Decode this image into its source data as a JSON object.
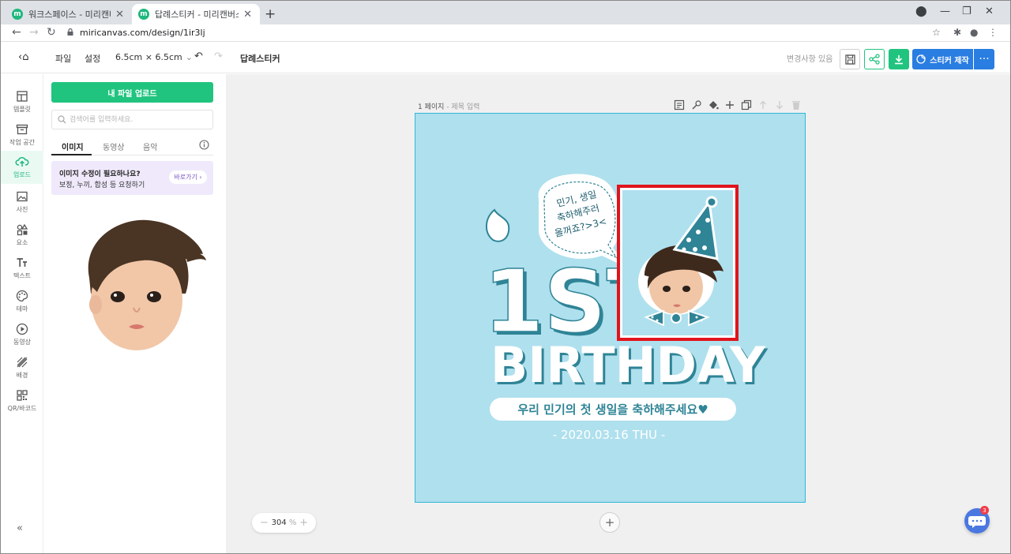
{
  "browser": {
    "tabs": [
      {
        "title": "워크스페이스 - 미리캔버스",
        "active": false
      },
      {
        "title": "답례스티커 - 미리캔버스",
        "active": true
      }
    ],
    "favicon_letter": "m",
    "url": "miricanvas.com/design/1ir3lj"
  },
  "header": {
    "menu_file": "파일",
    "menu_settings": "설정",
    "size": "6.5cm × 6.5cm",
    "doc_title": "답례스티커",
    "save_status": "변경사항 있음",
    "sticker_button": "스티커 제작",
    "more": "···"
  },
  "rail": {
    "items": [
      {
        "label": "템플릿",
        "icon": "template-icon"
      },
      {
        "label": "작업 공간",
        "icon": "workspace-icon"
      },
      {
        "label": "업로드",
        "icon": "upload-icon",
        "active": true
      },
      {
        "label": "사진",
        "icon": "photo-icon"
      },
      {
        "label": "요소",
        "icon": "elements-icon"
      },
      {
        "label": "텍스트",
        "icon": "text-icon"
      },
      {
        "label": "테마",
        "icon": "palette-icon"
      },
      {
        "label": "동영상",
        "icon": "video-icon"
      },
      {
        "label": "배경",
        "icon": "background-icon"
      },
      {
        "label": "QR/바코드",
        "icon": "qr-icon"
      }
    ],
    "collapse": "«"
  },
  "panel": {
    "upload_button": "내 파일 업로드",
    "search_placeholder": "검색어를 입력하세요.",
    "tabs": [
      "이미지",
      "동영상",
      "음악"
    ],
    "promo_title": "이미지 수정이 필요하나요?",
    "promo_sub": "보정, 누끼, 합성 등 요청하기",
    "promo_button": "바로가기 ›"
  },
  "workspace": {
    "page_number": "1 페이지",
    "page_title_placeholder": "- 제목 입력",
    "zoom_value": "304",
    "zoom_unit": "%",
    "zoom_minus": "−",
    "zoom_plus": "+",
    "add_page": "+",
    "chat_badge": "3"
  },
  "design": {
    "bubble_text": [
      "민기, 생일",
      "축하해주러",
      "올꺼죠?>3<"
    ],
    "big_text": "1ST",
    "birthday": "BIRTHDAY",
    "banner": "우리 민기의 첫 생일을 축하해주세요♥",
    "date": "- 2020.03.16 THU -",
    "colors": {
      "background": "#afe0ee",
      "teal": "#2f8496",
      "selection": "#e0141c",
      "accent_green": "#21c47f",
      "accent_blue": "#2a7de1"
    }
  }
}
